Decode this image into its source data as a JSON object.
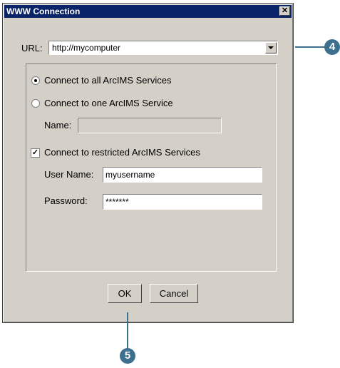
{
  "dialog": {
    "title": "WWW Connection",
    "close_glyph": "✕",
    "url_label": "URL:",
    "url_value": "http://mycomputer",
    "radio_all": "Connect to all ArcIMS Services",
    "radio_one": "Connect to one ArcIMS Service",
    "name_label": "Name:",
    "name_value": "",
    "checkbox_restricted": "Connect to restricted ArcIMS Services",
    "check_glyph": "✓",
    "username_label": "User Name:",
    "username_value": "myusername",
    "password_label": "Password:",
    "password_value": "*******",
    "ok_label": "OK",
    "cancel_label": "Cancel"
  },
  "callouts": {
    "step4": "4",
    "step5": "5",
    "color": "#3d6f8f"
  }
}
